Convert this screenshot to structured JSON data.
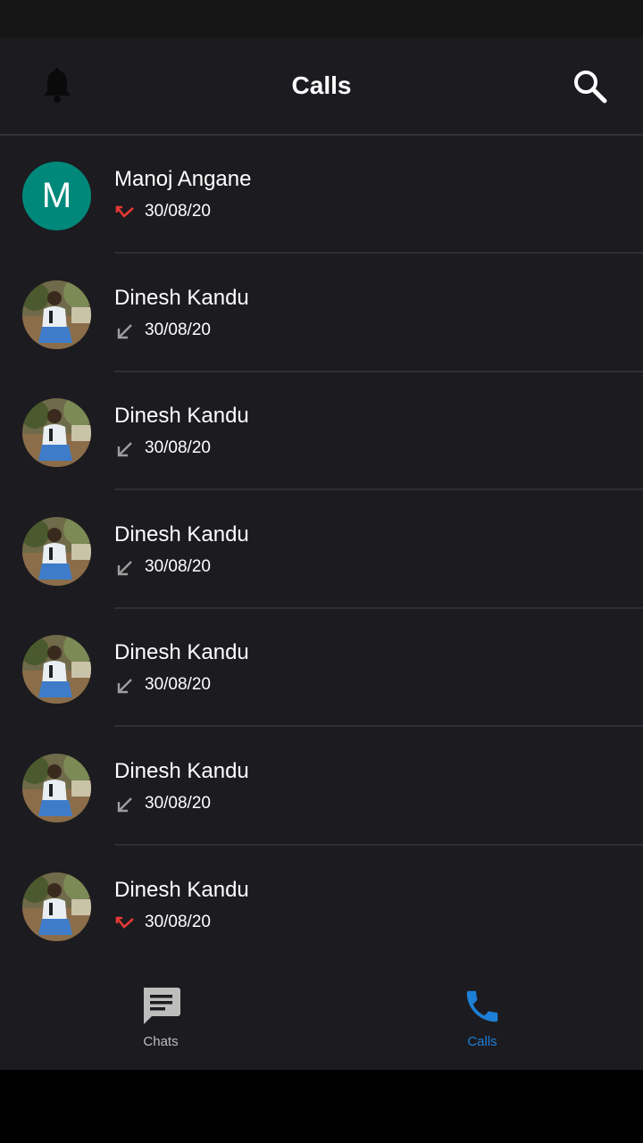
{
  "app_bar": {
    "title": "Calls",
    "left_icon": "bell-icon",
    "right_icon": "search-icon"
  },
  "calls": [
    {
      "name": "Manoj Angane",
      "date": "30/08/20",
      "avatar": "letter",
      "avatar_letter": "M",
      "call_type": "missed"
    },
    {
      "name": "Dinesh Kandu",
      "date": "30/08/20",
      "avatar": "photo",
      "avatar_letter": "",
      "call_type": "incoming"
    },
    {
      "name": "Dinesh Kandu",
      "date": "30/08/20",
      "avatar": "photo",
      "avatar_letter": "",
      "call_type": "incoming"
    },
    {
      "name": "Dinesh Kandu",
      "date": "30/08/20",
      "avatar": "photo",
      "avatar_letter": "",
      "call_type": "incoming"
    },
    {
      "name": "Dinesh Kandu",
      "date": "30/08/20",
      "avatar": "photo",
      "avatar_letter": "",
      "call_type": "incoming"
    },
    {
      "name": "Dinesh Kandu",
      "date": "30/08/20",
      "avatar": "photo",
      "avatar_letter": "",
      "call_type": "incoming"
    },
    {
      "name": "Dinesh Kandu",
      "date": "30/08/20",
      "avatar": "photo",
      "avatar_letter": "",
      "call_type": "missed"
    }
  ],
  "bottom_nav": {
    "items": [
      {
        "label": "Chats",
        "icon": "chat-icon",
        "active": false
      },
      {
        "label": "Calls",
        "icon": "phone-icon",
        "active": true
      }
    ]
  },
  "colors": {
    "background": "#1c1b1f",
    "missed": "#e53935",
    "incoming": "#9e9e9e",
    "active_nav": "#1e7fd6",
    "inactive_nav": "#bdbdbd",
    "avatar_letter_bg": "#00897b"
  }
}
